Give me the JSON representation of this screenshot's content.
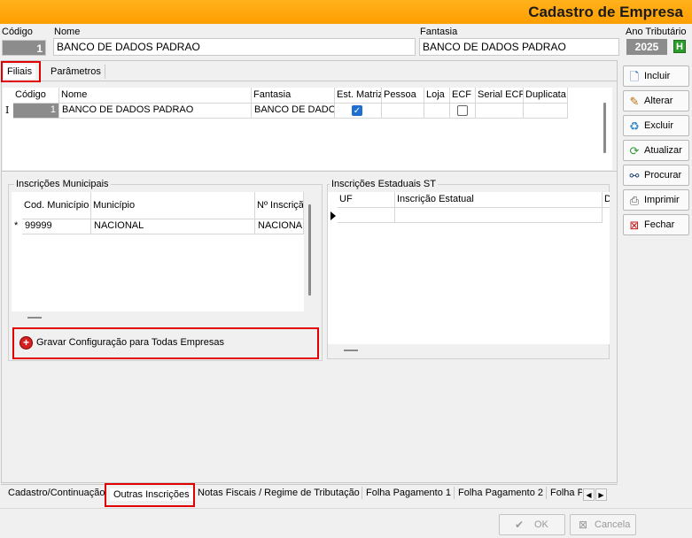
{
  "window": {
    "title": "Cadastro de Empresa"
  },
  "header": {
    "codigo_label": "Código",
    "codigo_value": "1",
    "nome_label": "Nome",
    "nome_value": "BANCO DE DADOS PADRAO",
    "fantasia_label": "Fantasia",
    "fantasia_value": "BANCO DE DADOS PADRAO",
    "ano_label": "Ano Tributário",
    "ano_value": "2025",
    "ano_button": "H"
  },
  "top_tabs": [
    "Filiais",
    "Parâmetros"
  ],
  "filiais_grid": {
    "columns": [
      "Código",
      "Nome",
      "Fantasia",
      "Est. Matriz",
      "Pessoa",
      "Loja",
      "ECF",
      "Serial ECF",
      "Duplicata"
    ],
    "row": {
      "indicator": "I",
      "codigo": "1",
      "nome": "BANCO DE DADOS PADRAO",
      "fantasia": "BANCO DE DADOS PADRAO",
      "est_matriz": true,
      "pessoa": "",
      "loja": "",
      "ecf": false,
      "serial_ecf": "",
      "duplicata": ""
    }
  },
  "inscricoes_municipais": {
    "title": "Inscrições Municipais",
    "columns": [
      "Cod. Município",
      "Município",
      "Nº Inscrição"
    ],
    "row": {
      "indicator": "*",
      "cod": "99999",
      "municipio": "NACIONAL",
      "inscricao": "NACIONAL"
    }
  },
  "gravar_button": {
    "label": "Gravar Configuração para Todas Empresas",
    "icon": "add-circle-icon"
  },
  "inscricoes_estaduais": {
    "title": "Inscrições Estaduais ST",
    "columns": [
      "UF",
      "Inscrição Estatual",
      "D"
    ]
  },
  "side_buttons": [
    {
      "label": "Incluir",
      "icon": "new-document-icon"
    },
    {
      "label": "Alterar",
      "icon": "edit-icon"
    },
    {
      "label": "Excluir",
      "icon": "delete-icon"
    },
    {
      "label": "Atualizar",
      "icon": "refresh-icon"
    },
    {
      "label": "Procurar",
      "icon": "binoculars-icon"
    },
    {
      "label": "Imprimir",
      "icon": "printer-icon"
    },
    {
      "label": "Fechar",
      "icon": "close-window-icon"
    }
  ],
  "bottom_tabs": [
    "Cadastro/Continuação",
    "Outras Inscrições",
    "Notas Fiscais / Regime de Tributação",
    "Folha Pagamento 1",
    "Folha Pagamento 2",
    "Folha P"
  ],
  "footer": {
    "ok_label": "OK",
    "cancel_label": "Cancela"
  },
  "colors": {
    "title_bar": "#ff9f00",
    "highlight_box": "#e00000",
    "checkbox_checked": "#1f6fd1"
  }
}
